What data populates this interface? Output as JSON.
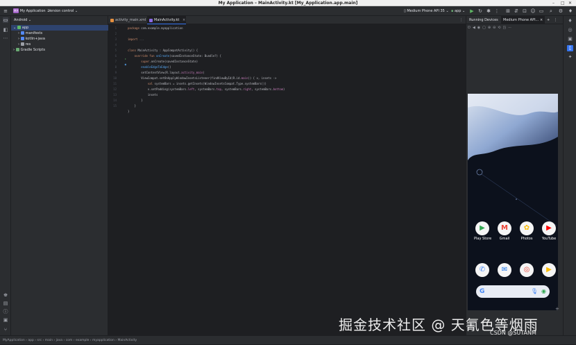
{
  "window": {
    "title": "My Application – MainActivity.kt [My_Application.app.main]",
    "controls": [
      "–",
      "□",
      "✕"
    ]
  },
  "toolbar": {
    "menu_icon": "hamburger-icon",
    "project_badge": "MA",
    "project_name": "My Application",
    "vcs_label": "Version control",
    "device_selector": "Medium Phone API 35",
    "run_config": "app"
  },
  "project_panel": {
    "header": "Android",
    "tree": [
      {
        "label": "app",
        "level": 0,
        "expanded": true,
        "selected": true
      },
      {
        "label": "manifests",
        "level": 1
      },
      {
        "label": "kotlin+java",
        "level": 1
      },
      {
        "label": "res",
        "level": 1
      },
      {
        "label": "Gradle Scripts",
        "level": 0
      }
    ]
  },
  "editor": {
    "tabs": [
      {
        "label": "activity_main.xml",
        "active": false
      },
      {
        "label": "MainActivity.kt",
        "active": true
      }
    ],
    "line_numbers": [
      "1",
      "2",
      "3",
      "4",
      "5",
      "6",
      "7",
      "8",
      "9",
      "10",
      "11",
      "12",
      "13",
      "14",
      "15"
    ],
    "code": [
      {
        "tokens": [
          {
            "t": "package ",
            "c": "k"
          },
          {
            "t": "com.example.myapplication",
            "c": ""
          }
        ]
      },
      {
        "tokens": []
      },
      {
        "tokens": [
          {
            "t": "import ",
            "c": "k"
          },
          {
            "t": "...",
            "c": "d"
          }
        ]
      },
      {
        "tokens": []
      },
      {
        "tokens": [
          {
            "t": "class ",
            "c": "k"
          },
          {
            "t": "MainActivity : AppCompatActivity() {",
            "c": ""
          }
        ]
      },
      {
        "tokens": [
          {
            "t": "    override fun ",
            "c": "k"
          },
          {
            "t": "onCreate",
            "c": "f"
          },
          {
            "t": "(savedInstanceState: Bundle?) {",
            "c": ""
          }
        ]
      },
      {
        "tokens": [
          {
            "t": "        super",
            "c": "k"
          },
          {
            "t": ".onCreate(savedInstanceState)",
            "c": ""
          }
        ]
      },
      {
        "tokens": [
          {
            "t": "        enableEdgeToEdge",
            "c": "f"
          },
          {
            "t": "()",
            "c": ""
          }
        ]
      },
      {
        "tokens": [
          {
            "t": "        setContentView(R.layout.",
            "c": ""
          },
          {
            "t": "activity_main",
            "c": "p"
          },
          {
            "t": ")",
            "c": ""
          }
        ]
      },
      {
        "tokens": [
          {
            "t": "        ViewCompat.setOnApplyWindowInsetsListener(findViewById(R.id.",
            "c": ""
          },
          {
            "t": "main",
            "c": "p"
          },
          {
            "t": ")) { v, insets ->",
            "c": ""
          }
        ]
      },
      {
        "tokens": [
          {
            "t": "            val ",
            "c": "k"
          },
          {
            "t": "systemBars = insets.getInsets(WindowInsetsCompat.Type.systemBars())",
            "c": ""
          }
        ]
      },
      {
        "tokens": [
          {
            "t": "            v.setPadding(systemBars.",
            "c": ""
          },
          {
            "t": "left",
            "c": "p"
          },
          {
            "t": ", systemBars.",
            "c": ""
          },
          {
            "t": "top",
            "c": "p"
          },
          {
            "t": ", systemBars.",
            "c": ""
          },
          {
            "t": "right",
            "c": "p"
          },
          {
            "t": ", systemBars.",
            "c": ""
          },
          {
            "t": "bottom",
            "c": "p"
          },
          {
            "t": ")",
            "c": ""
          }
        ]
      },
      {
        "tokens": [
          {
            "t": "            insets",
            "c": ""
          }
        ]
      },
      {
        "tokens": [
          {
            "t": "        }",
            "c": ""
          }
        ]
      },
      {
        "tokens": [
          {
            "t": "    }",
            "c": ""
          }
        ]
      },
      {
        "tokens": [
          {
            "t": "}",
            "c": ""
          }
        ]
      }
    ]
  },
  "running_devices": {
    "title": "Running Devices",
    "device_tab": "Medium Phone API..."
  },
  "phone": {
    "apps_row1": [
      {
        "label": "Play Store",
        "glyph": "▶",
        "color": "#34a853"
      },
      {
        "label": "Gmail",
        "glyph": "M",
        "color": "#ea4335"
      },
      {
        "label": "Photos",
        "glyph": "✿",
        "color": "#fbbc05"
      },
      {
        "label": "YouTube",
        "glyph": "▶",
        "color": "#ff0000"
      }
    ],
    "apps_row2": [
      {
        "label": "",
        "glyph": "✆",
        "color": "#4285f4"
      },
      {
        "label": "",
        "glyph": "✉",
        "color": "#1a73e8"
      },
      {
        "label": "",
        "glyph": "◎",
        "color": "#ea4335"
      },
      {
        "label": "",
        "glyph": "▶",
        "color": "#fbbc05"
      }
    ],
    "search_logo": "G"
  },
  "statusbar": {
    "breadcrumb": "MyApplication  ›  app  ›  src  ›  main  ›  java  ›  com  ›  example  ›  myapplication  ›  MainActivity"
  },
  "watermark": {
    "main": "掘金技术社区 @ 天氰色等烟雨",
    "sub": "CSDN @SUTANM"
  },
  "colors": {
    "accent": "#3574f0",
    "bg": "#1e1f22",
    "panel": "#2b2d30"
  }
}
